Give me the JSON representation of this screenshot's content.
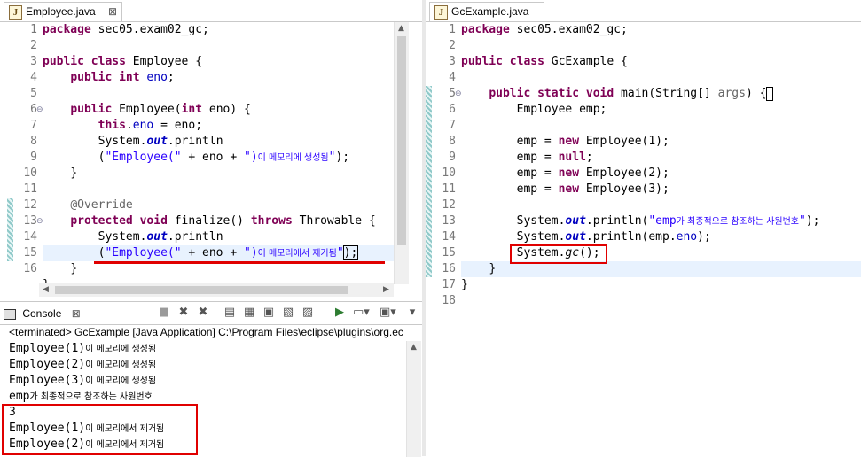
{
  "left_editor": {
    "tab_label": "Employee.java",
    "file_icon_letter": "J",
    "close_symbol": "⊠",
    "line_numbers": [
      "1",
      "2",
      "3",
      "4",
      "5",
      "6",
      "7",
      "8",
      "9",
      "10",
      "11",
      "12",
      "13",
      "14",
      "15",
      "16"
    ],
    "code": {
      "l1_kw": "package",
      "l1_rest": " sec05.exam02_gc;",
      "l3_kw1": "public",
      "l3_kw2": "class",
      "l3_rest": " Employee {",
      "l4_indent": "    ",
      "l4_kw1": "public",
      "l4_kw2": "int",
      "l4_fld": "eno",
      "l4_end": ";",
      "l6_indent": "    ",
      "l6_kw1": "public",
      "l6_mid": " Employee(",
      "l6_kw2": "int",
      "l6_end": " eno) {",
      "l7_indent": "        ",
      "l7_kw": "this",
      "l7_dot": ".",
      "l7_fld": "eno",
      "l7_end": " = eno;",
      "l8_indent": "        ",
      "l8_a": "System.",
      "l8_out": "out",
      "l8_b": ".println",
      "l9_indent": "        ",
      "l9_a": "(",
      "l9_str1": "\"Employee(\"",
      "l9_b": " + eno + ",
      "l9_str2": "\")",
      "l9_ko": "이 메모리에 생성됨",
      "l9_str3": "\"",
      "l9_end": ");",
      "l10_indent": "    ",
      "l10_end": "}",
      "l12_indent": "    ",
      "l12_ann": "@Override",
      "l13_indent": "    ",
      "l13_kw1": "protected",
      "l13_kw2": "void",
      "l13_mid": " finalize() ",
      "l13_kw3": "throws",
      "l13_end": " Throwable {",
      "l14_indent": "        ",
      "l14_a": "System.",
      "l14_out": "out",
      "l14_b": ".println",
      "l15_indent": "        ",
      "l15_a": "(",
      "l15_str1": "\"Employee(\"",
      "l15_b": " + eno + ",
      "l15_str2": "\")",
      "l15_ko": "이 메모리에서 제거됨",
      "l15_str3": "\"",
      "l15_end": ");",
      "l16_indent": "    ",
      "l16_end": "}",
      "l17_end": "}"
    }
  },
  "right_editor": {
    "tab_label": "GcExample.java",
    "file_icon_letter": "J",
    "line_numbers": [
      "1",
      "2",
      "3",
      "4",
      "5",
      "6",
      "7",
      "8",
      "9",
      "10",
      "11",
      "12",
      "13",
      "14",
      "15",
      "16",
      "17",
      "18"
    ],
    "code": {
      "l1_kw": "package",
      "l1_rest": " sec05.exam02_gc;",
      "l3_kw1": "public",
      "l3_kw2": "class",
      "l3_rest": " GcExample {",
      "l5_indent": "    ",
      "l5_kw1": "public",
      "l5_kw2": "static",
      "l5_kw3": "void",
      "l5_mid": " main(String[] ",
      "l5_arg": "args",
      "l5_end": ") {",
      "l6_indent": "        ",
      "l6_rest": "Employee emp;",
      "l8_indent": "        ",
      "l8_a": "emp = ",
      "l8_kw": "new",
      "l8_b": " Employee(1);",
      "l9_indent": "        ",
      "l9_a": "emp = ",
      "l9_kw": "null",
      "l9_b": ";",
      "l10_indent": "        ",
      "l10_a": "emp = ",
      "l10_kw": "new",
      "l10_b": " Employee(2);",
      "l11_indent": "        ",
      "l11_a": "emp = ",
      "l11_kw": "new",
      "l11_b": " Employee(3);",
      "l13_indent": "        ",
      "l13_a": "System.",
      "l13_out": "out",
      "l13_b": ".println(",
      "l13_str1": "\"emp",
      "l13_ko": "가 최종적으로 참조하는 사원번호",
      "l13_str2": "\"",
      "l13_end": ");",
      "l14_indent": "        ",
      "l14_a": "System.",
      "l14_out": "out",
      "l14_b": ".println(emp.",
      "l14_fld": "eno",
      "l14_end": ");",
      "l15_indent": "        ",
      "l15_a": "System.",
      "l15_gc": "gc",
      "l15_end": "();",
      "l16_indent": "    ",
      "l16_end": "}",
      "l17_end": "}"
    }
  },
  "console": {
    "tab_label": "Console",
    "status_line": "<terminated> GcExample [Java Application] C:\\Program Files\\eclipse\\plugins\\org.ec",
    "output": [
      {
        "a": "Employee(1)",
        "ko": "이 메모리에 생성됨"
      },
      {
        "a": "Employee(2)",
        "ko": "이 메모리에 생성됨"
      },
      {
        "a": "Employee(3)",
        "ko": "이 메모리에 생성됨"
      },
      {
        "a": "emp",
        "ko": "가 최종적으로 참조하는 사원번호"
      },
      {
        "a": "3",
        "ko": ""
      },
      {
        "a": "Employee(1)",
        "ko": "이 메모리에서 제거됨"
      },
      {
        "a": "Employee(2)",
        "ko": "이 메모리에서 제거됨"
      }
    ],
    "toolbar_icons": [
      "stop-icon",
      "remove-launch-icon",
      "remove-all-icon",
      "scroll-lock-icon",
      "word-wrap-icon",
      "pin-icon",
      "display-console-icon",
      "open-console-icon",
      "new-console-icon",
      "view-menu-icon"
    ]
  },
  "colors": {
    "keyword": "#7f0055",
    "string": "#2a00ff",
    "field": "#0000c0",
    "annotation": "#646464",
    "highlight_red": "#e00000"
  }
}
